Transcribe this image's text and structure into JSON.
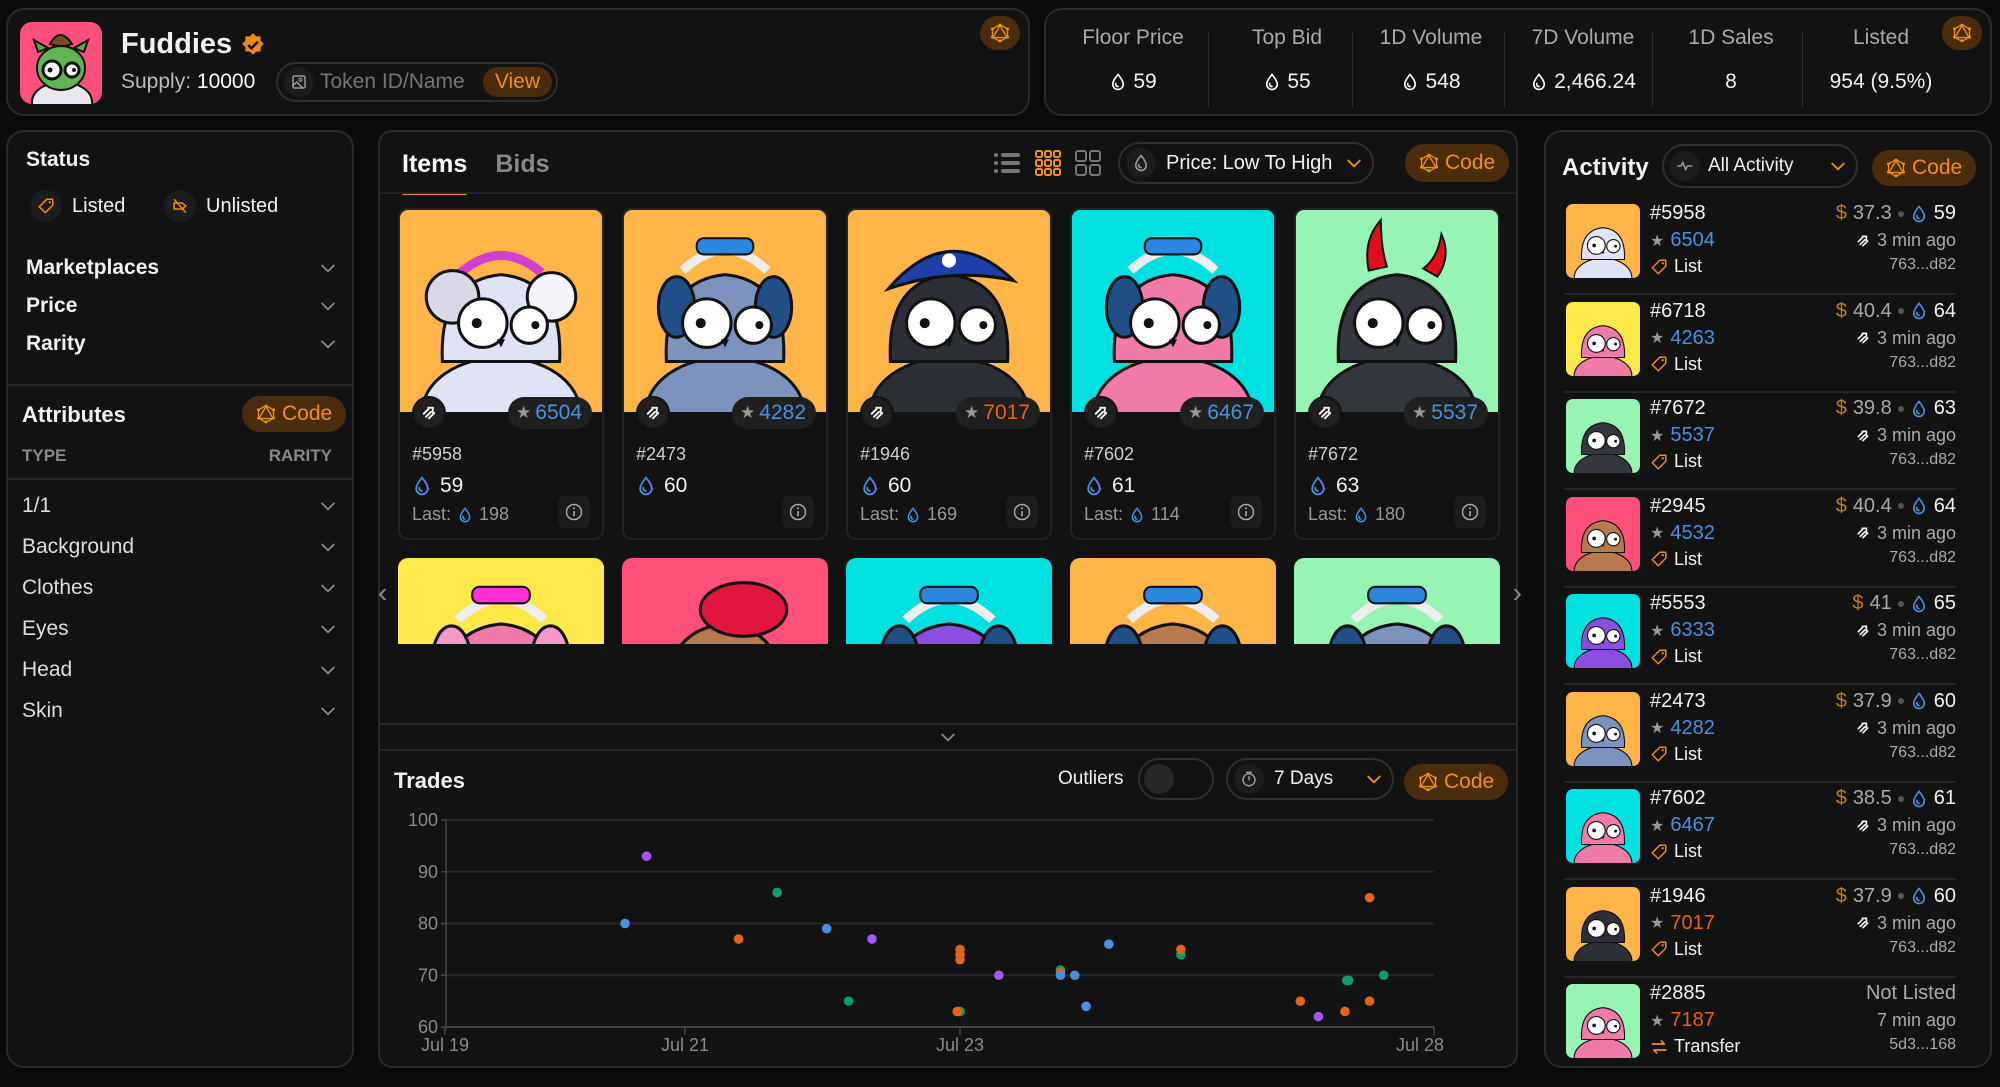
{
  "collection": {
    "name": "Fuddies",
    "verified": true,
    "supply_label": "Supply:",
    "supply_value": "10000",
    "token_search_placeholder": "Token ID/Name",
    "view_label": "View"
  },
  "stats": [
    {
      "label": "Floor Price",
      "value": "59",
      "icon": "sui-drop-icon"
    },
    {
      "label": "Top Bid",
      "value": "55",
      "icon": "sui-drop-icon"
    },
    {
      "label": "1D Volume",
      "value": "548",
      "icon": "sui-drop-icon"
    },
    {
      "label": "7D Volume",
      "value": "2,466.24",
      "icon": "sui-drop-icon"
    },
    {
      "label": "1D Sales",
      "value": "8",
      "icon": null
    },
    {
      "label": "Listed",
      "value": "954 (9.5%)",
      "icon": null
    }
  ],
  "sidebar": {
    "status_title": "Status",
    "status_options": [
      {
        "label": "Listed",
        "icon": "tag-icon"
      },
      {
        "label": "Unlisted",
        "icon": "tag-off-icon"
      }
    ],
    "filters": [
      "Marketplaces",
      "Price",
      "Rarity"
    ],
    "attributes_title": "Attributes",
    "code_label": "Code",
    "col_type": "TYPE",
    "col_rarity": "RARITY",
    "attributes": [
      "1/1",
      "Background",
      "Clothes",
      "Eyes",
      "Head",
      "Skin"
    ]
  },
  "main": {
    "tabs": [
      "Items",
      "Bids"
    ],
    "active_tab": "Items",
    "sort_label": "Price: Low To High",
    "code_label": "Code",
    "last_label": "Last:",
    "items": [
      {
        "id": "#5958",
        "rank": "6504",
        "rank_color": "#4a90e2",
        "price": "59",
        "last": "198",
        "bg": "#ffb547",
        "body": "#dfe3f3",
        "hat": "earmuffs"
      },
      {
        "id": "#2473",
        "rank": "4282",
        "rank_color": "#4a90e2",
        "price": "60",
        "last": null,
        "bg": "#ffb547",
        "body": "#7c93bd",
        "hat": "headphones"
      },
      {
        "id": "#1946",
        "rank": "7017",
        "rank_color": "#e5621c",
        "price": "60",
        "last": "169",
        "bg": "#ffb547",
        "body": "#2d2f36",
        "hat": "pirate"
      },
      {
        "id": "#7602",
        "rank": "6467",
        "rank_color": "#4a90e2",
        "price": "61",
        "last": "114",
        "bg": "#00e0e0",
        "body": "#f07aa8",
        "hat": "headphones"
      },
      {
        "id": "#7672",
        "rank": "5537",
        "rank_color": "#4a90e2",
        "price": "63",
        "last": "180",
        "bg": "#96f5b4",
        "body": "#34363d",
        "hat": "horns"
      }
    ],
    "items_row2": [
      {
        "bg": "#ffe84a",
        "body": "#f07aa8",
        "hat": "pink-headphones"
      },
      {
        "bg": "#ff4f7b",
        "body": "#b77a4e",
        "hat": "beret"
      },
      {
        "bg": "#00e0e0",
        "body": "#8a4fe0",
        "hat": "headphones"
      },
      {
        "bg": "#ffb547",
        "body": "#b77a4e",
        "hat": "headphones"
      },
      {
        "bg": "#96f5b4",
        "body": "#7c93bd",
        "hat": "headphones"
      }
    ]
  },
  "trades": {
    "title": "Trades",
    "outliers_label": "Outliers",
    "outliers_on": false,
    "range_label": "7 Days",
    "code_label": "Code"
  },
  "chart_data": {
    "type": "scatter",
    "title": "Trades",
    "xlabel": "",
    "ylabel": "",
    "ylim": [
      60,
      100
    ],
    "yticks": [
      60,
      70,
      80,
      90,
      100
    ],
    "x_unit": "days since Jul 19",
    "xticks": [
      {
        "value": 0,
        "label": "Jul 19"
      },
      {
        "value": 2,
        "label": "Jul 21"
      },
      {
        "value": 4,
        "label": "Jul 23"
      },
      {
        "value": 9,
        "label": "Jul 28"
      }
    ],
    "grid": true,
    "legend": "none",
    "colors": {
      "blue": "#4a90e2",
      "purple": "#a259f0",
      "orange": "#e5621c",
      "green": "#0f9d6e"
    },
    "points": [
      {
        "x": 1.5,
        "y": 80,
        "c": "blue"
      },
      {
        "x": 1.68,
        "y": 93,
        "c": "purple"
      },
      {
        "x": 2.39,
        "y": 77,
        "c": "orange"
      },
      {
        "x": 2.67,
        "y": 86,
        "c": "green"
      },
      {
        "x": 3.03,
        "y": 79,
        "c": "blue"
      },
      {
        "x": 3.19,
        "y": 65,
        "c": "green"
      },
      {
        "x": 3.36,
        "y": 77,
        "c": "purple"
      },
      {
        "x": 4.0,
        "y": 75,
        "c": "orange"
      },
      {
        "x": 4.0,
        "y": 74,
        "c": "orange"
      },
      {
        "x": 4.0,
        "y": 73,
        "c": "orange"
      },
      {
        "x": 4.0,
        "y": 63,
        "c": "green"
      },
      {
        "x": 3.98,
        "y": 63,
        "c": "orange"
      },
      {
        "x": 4.41,
        "y": 70,
        "c": "purple"
      },
      {
        "x": 5.06,
        "y": 71,
        "c": "green"
      },
      {
        "x": 5.06,
        "y": 70.5,
        "c": "orange"
      },
      {
        "x": 5.06,
        "y": 70,
        "c": "blue"
      },
      {
        "x": 5.21,
        "y": 70,
        "c": "blue"
      },
      {
        "x": 5.33,
        "y": 64,
        "c": "blue"
      },
      {
        "x": 5.57,
        "y": 76,
        "c": "blue"
      },
      {
        "x": 6.33,
        "y": 74,
        "c": "green"
      },
      {
        "x": 6.33,
        "y": 75,
        "c": "orange"
      },
      {
        "x": 7.59,
        "y": 65,
        "c": "orange"
      },
      {
        "x": 7.78,
        "y": 62,
        "c": "purple"
      },
      {
        "x": 8.06,
        "y": 63,
        "c": "orange"
      },
      {
        "x": 8.08,
        "y": 69,
        "c": "green"
      },
      {
        "x": 8.1,
        "y": 69,
        "c": "green"
      },
      {
        "x": 8.32,
        "y": 85,
        "c": "orange"
      },
      {
        "x": 8.32,
        "y": 65,
        "c": "orange"
      },
      {
        "x": 8.47,
        "y": 70,
        "c": "green"
      }
    ]
  },
  "activity": {
    "title": "Activity",
    "filter_label": "All Activity",
    "code_label": "Code",
    "rows": [
      {
        "id": "#5958",
        "rank": "6504",
        "rank_color": "#4a90e2",
        "type": "List",
        "usd": "37.3",
        "price": "59",
        "time": "3 min ago",
        "addr": "763...d82",
        "bg": "#ffb547",
        "body": "#dfe3f3"
      },
      {
        "id": "#6718",
        "rank": "4263",
        "rank_color": "#4a90e2",
        "type": "List",
        "usd": "40.4",
        "price": "64",
        "time": "3 min ago",
        "addr": "763...d82",
        "bg": "#ffe84a",
        "body": "#f07aa8"
      },
      {
        "id": "#7672",
        "rank": "5537",
        "rank_color": "#4a90e2",
        "type": "List",
        "usd": "39.8",
        "price": "63",
        "time": "3 min ago",
        "addr": "763...d82",
        "bg": "#96f5b4",
        "body": "#34363d"
      },
      {
        "id": "#2945",
        "rank": "4532",
        "rank_color": "#4a90e2",
        "type": "List",
        "usd": "40.4",
        "price": "64",
        "time": "3 min ago",
        "addr": "763...d82",
        "bg": "#ff4f7b",
        "body": "#b77a4e"
      },
      {
        "id": "#5553",
        "rank": "6333",
        "rank_color": "#4a90e2",
        "type": "List",
        "usd": "41",
        "price": "65",
        "time": "3 min ago",
        "addr": "763...d82",
        "bg": "#00e0e0",
        "body": "#8a4fe0"
      },
      {
        "id": "#2473",
        "rank": "4282",
        "rank_color": "#4a90e2",
        "type": "List",
        "usd": "37.9",
        "price": "60",
        "time": "3 min ago",
        "addr": "763...d82",
        "bg": "#ffb547",
        "body": "#7c93bd"
      },
      {
        "id": "#7602",
        "rank": "6467",
        "rank_color": "#4a90e2",
        "type": "List",
        "usd": "38.5",
        "price": "61",
        "time": "3 min ago",
        "addr": "763...d82",
        "bg": "#00e0e0",
        "body": "#f07aa8"
      },
      {
        "id": "#1946",
        "rank": "7017",
        "rank_color": "#e5621c",
        "type": "List",
        "usd": "37.9",
        "price": "60",
        "time": "3 min ago",
        "addr": "763...d82",
        "bg": "#ffb547",
        "body": "#2d2f36"
      },
      {
        "id": "#2885",
        "rank": "7187",
        "rank_color": "#e5621c",
        "type": "Transfer",
        "status": "Not Listed",
        "time": "7 min ago",
        "addr": "5d3...168",
        "bg": "#96f5b4",
        "body": "#f07aa8"
      }
    ]
  }
}
